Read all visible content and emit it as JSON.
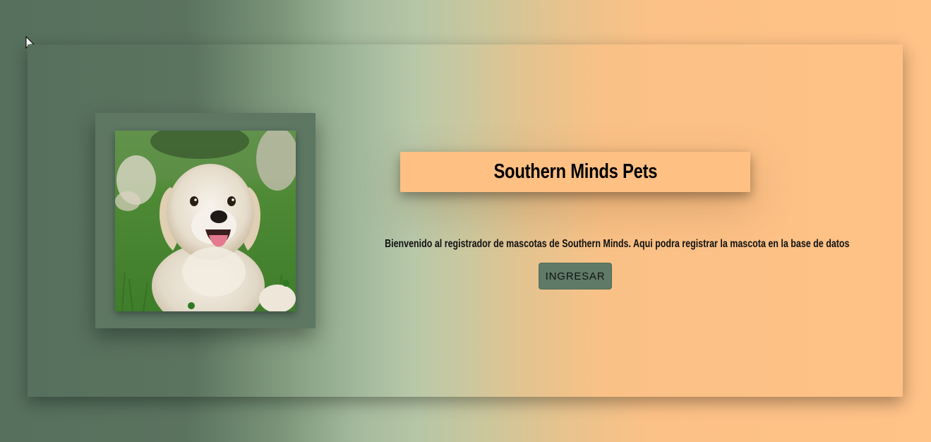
{
  "header": {
    "title": "Southern Minds Pets"
  },
  "main": {
    "welcome_text": "Bienvenido al registrador de mascotas de Southern Minds. Aqui podra registrar la mascota en la base de datos",
    "enter_button_label": "INGRESAR",
    "image_subject": "golden retriever puppy on grass"
  },
  "colors": {
    "gradient_start": "#56705d",
    "gradient_mid": "#b6c6a6",
    "gradient_end": "#ffc287",
    "title_box": "#ffc084",
    "frame": "#5d7763",
    "button": "#5f7a66"
  },
  "icons": {
    "cursor": "mouse-pointer-icon"
  }
}
